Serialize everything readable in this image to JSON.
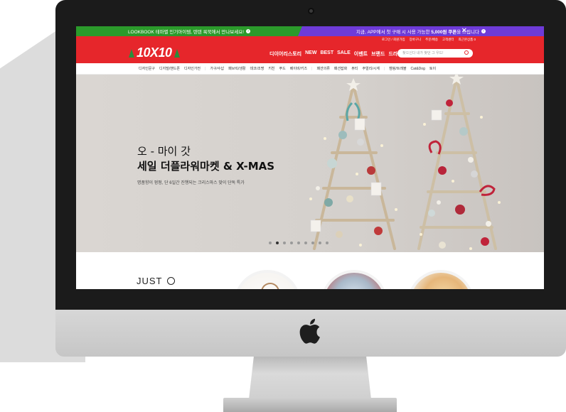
{
  "promo": {
    "left_text": "LOOKBOOK 테마별 인기아이템, 텐텐 룩북에서 만나보세요!",
    "right_text_prefix": "지금, APP에서 첫 구매 시 사용 가능한 ",
    "right_text_bold": "5,000원 쿠폰",
    "right_text_suffix": "을 드립니다",
    "close_glyph": "✕"
  },
  "header": {
    "brand": "10X10",
    "util_links": [
      "로그인 / 회원가입",
      "장바구니",
      "주문/배송",
      "고객센터",
      "최근본상품 0"
    ],
    "nav": [
      "디이어리스토리",
      "NEW",
      "BEST",
      "SALE",
      "이벤트",
      "브랜드",
      "드라마존"
    ],
    "search_placeholder": "찾으신다 내가 찾던 그 우드!"
  },
  "categories": [
    "디자인문구",
    "디지털/핸드폰",
    "디자인가전",
    "가구/수납",
    "패브릭/생활",
    "데코/조명",
    "키친",
    "푸드",
    "베이비/키즈",
    "패션의류",
    "패션잡화",
    "뷰티",
    "주얼리/시계",
    "캠핑/트래블",
    "Cat&Dog",
    "토이"
  ],
  "hero": {
    "title_line1": "오 - 마이 갓",
    "title_line2": "세일 더플라워마켓 & X-MAS",
    "subtitle": "명품향이 펑펑, 단 6일간 진행되는 크리스마스 맞이 단독 특가",
    "slide_count": 9,
    "active_slide": 1
  },
  "section": {
    "title": "JUST"
  }
}
